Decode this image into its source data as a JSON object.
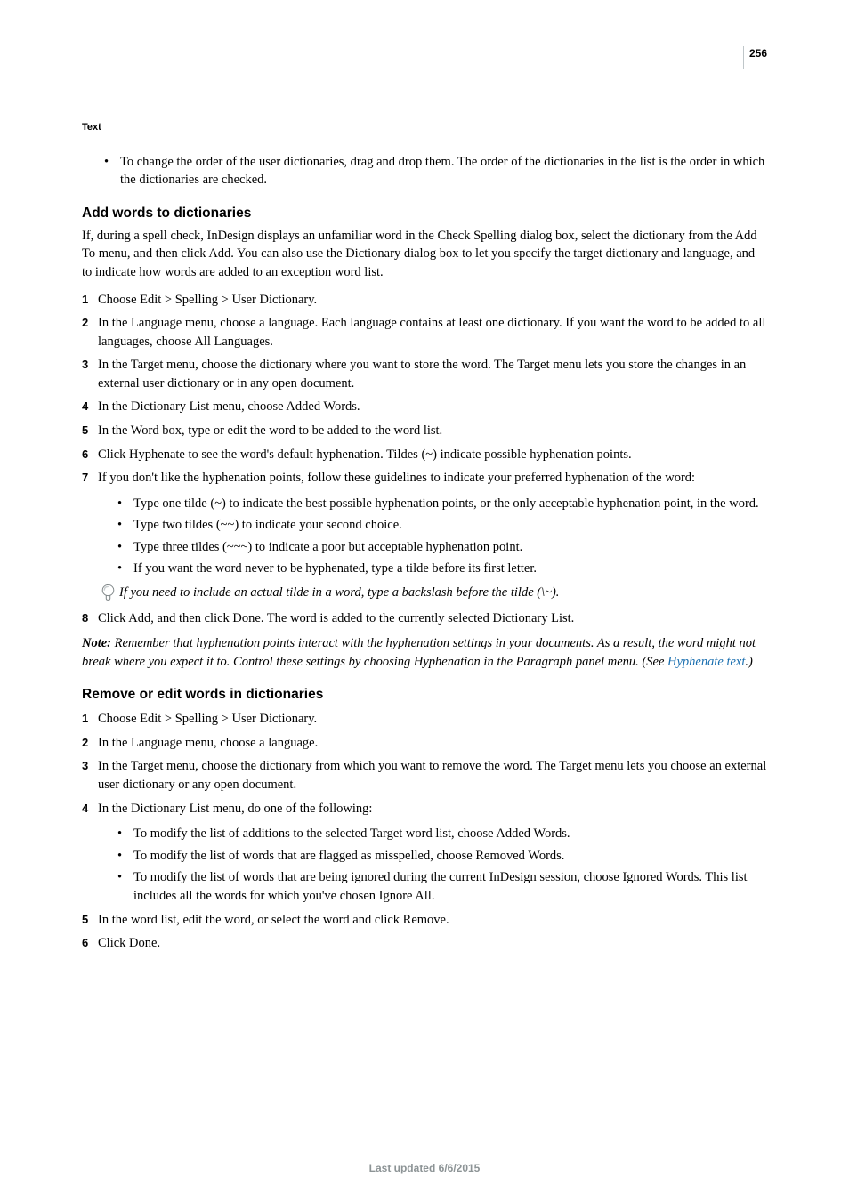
{
  "page_number": "256",
  "section_label": "Text",
  "intro_bullet": "To change the order of the user dictionaries, drag and drop them. The order of the dictionaries in the list is the order in which the dictionaries are checked.",
  "s1": {
    "heading": "Add words to dictionaries",
    "intro": "If, during a spell check, InDesign displays an unfamiliar word in the Check Spelling dialog box, select the dictionary from the Add To menu, and then click Add. You can also use the Dictionary dialog box to let you specify the target dictionary and language, and to indicate how words are added to an exception word list.",
    "steps": [
      "Choose Edit > Spelling > User Dictionary.",
      "In the Language menu, choose a language. Each language contains at least one dictionary. If you want the word to be added to all languages, choose All Languages.",
      "In the Target menu, choose the dictionary where you want to store the word. The Target menu lets you store the changes in an external user dictionary or in any open document.",
      "In the Dictionary List menu, choose Added Words.",
      "In the Word box, type or edit the word to be added to the word list.",
      "Click Hyphenate to see the word's default hyphenation. Tildes (~) indicate possible hyphenation points.",
      "If you don't like the hyphenation points, follow these guidelines to indicate your preferred hyphenation of the word:"
    ],
    "sub_bullets": [
      "Type one tilde (~) to indicate the best possible hyphenation points, or the only acceptable hyphenation point, in the word.",
      "Type two tildes (~~) to indicate your second choice.",
      "Type three tildes (~~~) to indicate a poor but acceptable hyphenation point.",
      "If you want the word never to be hyphenated, type a tilde before its first letter."
    ],
    "tip": "If you need to include an actual tilde in a word, type a backslash before the tilde (\\~).",
    "step8": "Click Add, and then click Done. The word is added to the currently selected Dictionary List.",
    "note_label": "Note: ",
    "note_text_a": "Remember that hyphenation points interact with the hyphenation settings in your documents. As a result, the word might not break where you expect it to. Control these settings by choosing Hyphenation in the Paragraph panel menu. (See ",
    "note_link": "Hyphenate text",
    "note_text_b": ".)"
  },
  "s2": {
    "heading": "Remove or edit words in dictionaries",
    "steps": [
      "Choose Edit > Spelling > User Dictionary.",
      "In the Language menu, choose a language.",
      "In the Target menu, choose the dictionary from which you want to remove the word. The Target menu lets you choose an external user dictionary or any open document.",
      "In the Dictionary List menu, do one of the following:"
    ],
    "sub_bullets": [
      "To modify the list of additions to the selected Target word list, choose Added Words.",
      "To modify the list of words that are flagged as misspelled, choose Removed Words.",
      "To modify the list of words that are being ignored during the current InDesign session, choose Ignored Words. This list includes all the words for which you've chosen Ignore All."
    ],
    "step5": "In the word list, edit the word, or select the word and click Remove.",
    "step6": "Click Done."
  },
  "footer": "Last updated 6/6/2015"
}
